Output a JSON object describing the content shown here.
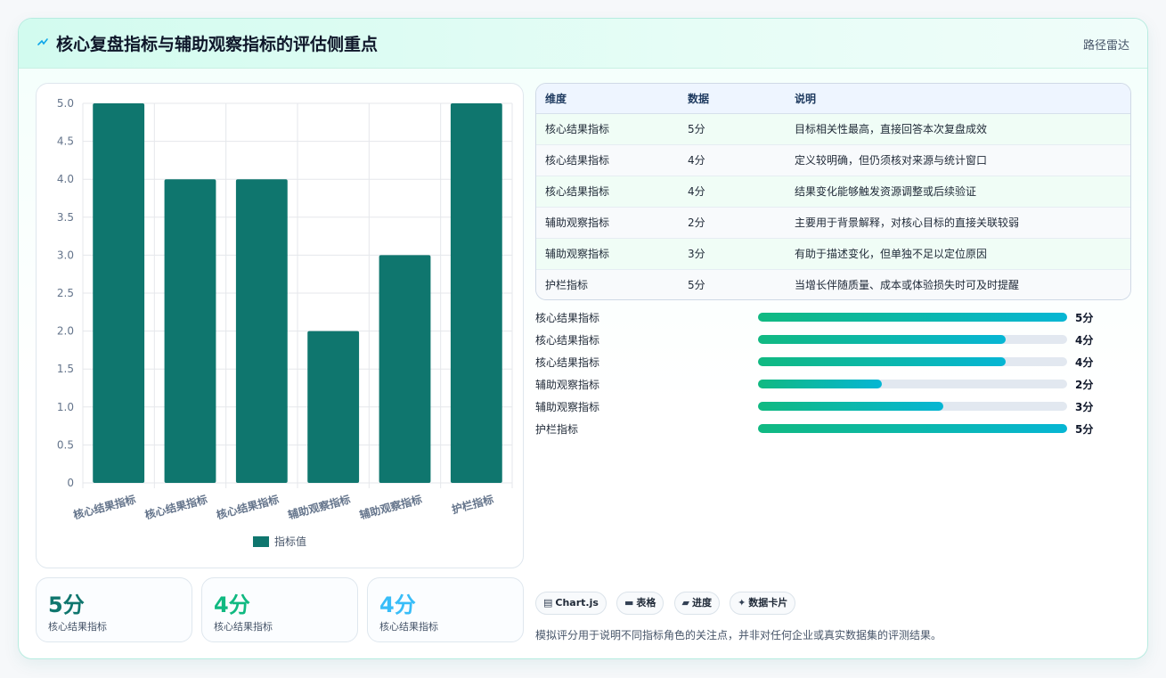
{
  "header": {
    "title": "核心复盘指标与辅助观察指标的评估侧重点",
    "tag": "路径雷达"
  },
  "chart_data": {
    "type": "bar",
    "categories": [
      "核心结果指标",
      "核心结果指标",
      "核心结果指标",
      "辅助观察指标",
      "辅助观察指标",
      "护栏指标"
    ],
    "series": [
      {
        "name": "指标值",
        "values": [
          5,
          4,
          4,
          2,
          3,
          5
        ]
      }
    ],
    "ylim": [
      0,
      5
    ],
    "yticks": [
      "0",
      "0.5",
      "1.0",
      "1.5",
      "2.0",
      "2.5",
      "3.0",
      "3.5",
      "4.0",
      "4.5",
      "5.0"
    ],
    "grid": true,
    "legend": "bottom",
    "bar_color": "#0f766e"
  },
  "table": {
    "headers": [
      "维度",
      "数据",
      "说明"
    ],
    "rows": [
      [
        "核心结果指标",
        "5分",
        "目标相关性最高，直接回答本次复盘成效"
      ],
      [
        "核心结果指标",
        "4分",
        "定义较明确，但仍须核对来源与统计窗口"
      ],
      [
        "核心结果指标",
        "4分",
        "结果变化能够触发资源调整或后续验证"
      ],
      [
        "辅助观察指标",
        "2分",
        "主要用于背景解释，对核心目标的直接关联较弱"
      ],
      [
        "辅助观察指标",
        "3分",
        "有助于描述变化，但单独不足以定位原因"
      ],
      [
        "护栏指标",
        "5分",
        "当增长伴随质量、成本或体验损失时可及时提醒"
      ]
    ]
  },
  "progress": [
    {
      "label": "核心结果指标",
      "value": 5,
      "max": 5,
      "text": "5分"
    },
    {
      "label": "核心结果指标",
      "value": 4,
      "max": 5,
      "text": "4分"
    },
    {
      "label": "核心结果指标",
      "value": 4,
      "max": 5,
      "text": "4分"
    },
    {
      "label": "辅助观察指标",
      "value": 2,
      "max": 5,
      "text": "2分"
    },
    {
      "label": "辅助观察指标",
      "value": 3,
      "max": 5,
      "text": "3分"
    },
    {
      "label": "护栏指标",
      "value": 5,
      "max": 5,
      "text": "5分"
    }
  ],
  "stats": [
    {
      "value": "5分",
      "label": "核心结果指标",
      "color": "#0f766e"
    },
    {
      "value": "4分",
      "label": "核心结果指标",
      "color": "#10b981"
    },
    {
      "value": "4分",
      "label": "核心结果指标",
      "color": "#38bdf8"
    }
  ],
  "chips": [
    {
      "icon": "chart-icon",
      "glyph": "▤",
      "label": "Chart.js"
    },
    {
      "icon": "table-icon",
      "glyph": "▬",
      "label": "表格"
    },
    {
      "icon": "progress-icon",
      "glyph": "▰",
      "label": "进度"
    },
    {
      "icon": "sparkle-icon",
      "glyph": "✦",
      "label": "数据卡片"
    }
  ],
  "note": "模拟评分用于说明不同指标角色的关注点，并非对任何企业或真实数据集的评测结果。"
}
